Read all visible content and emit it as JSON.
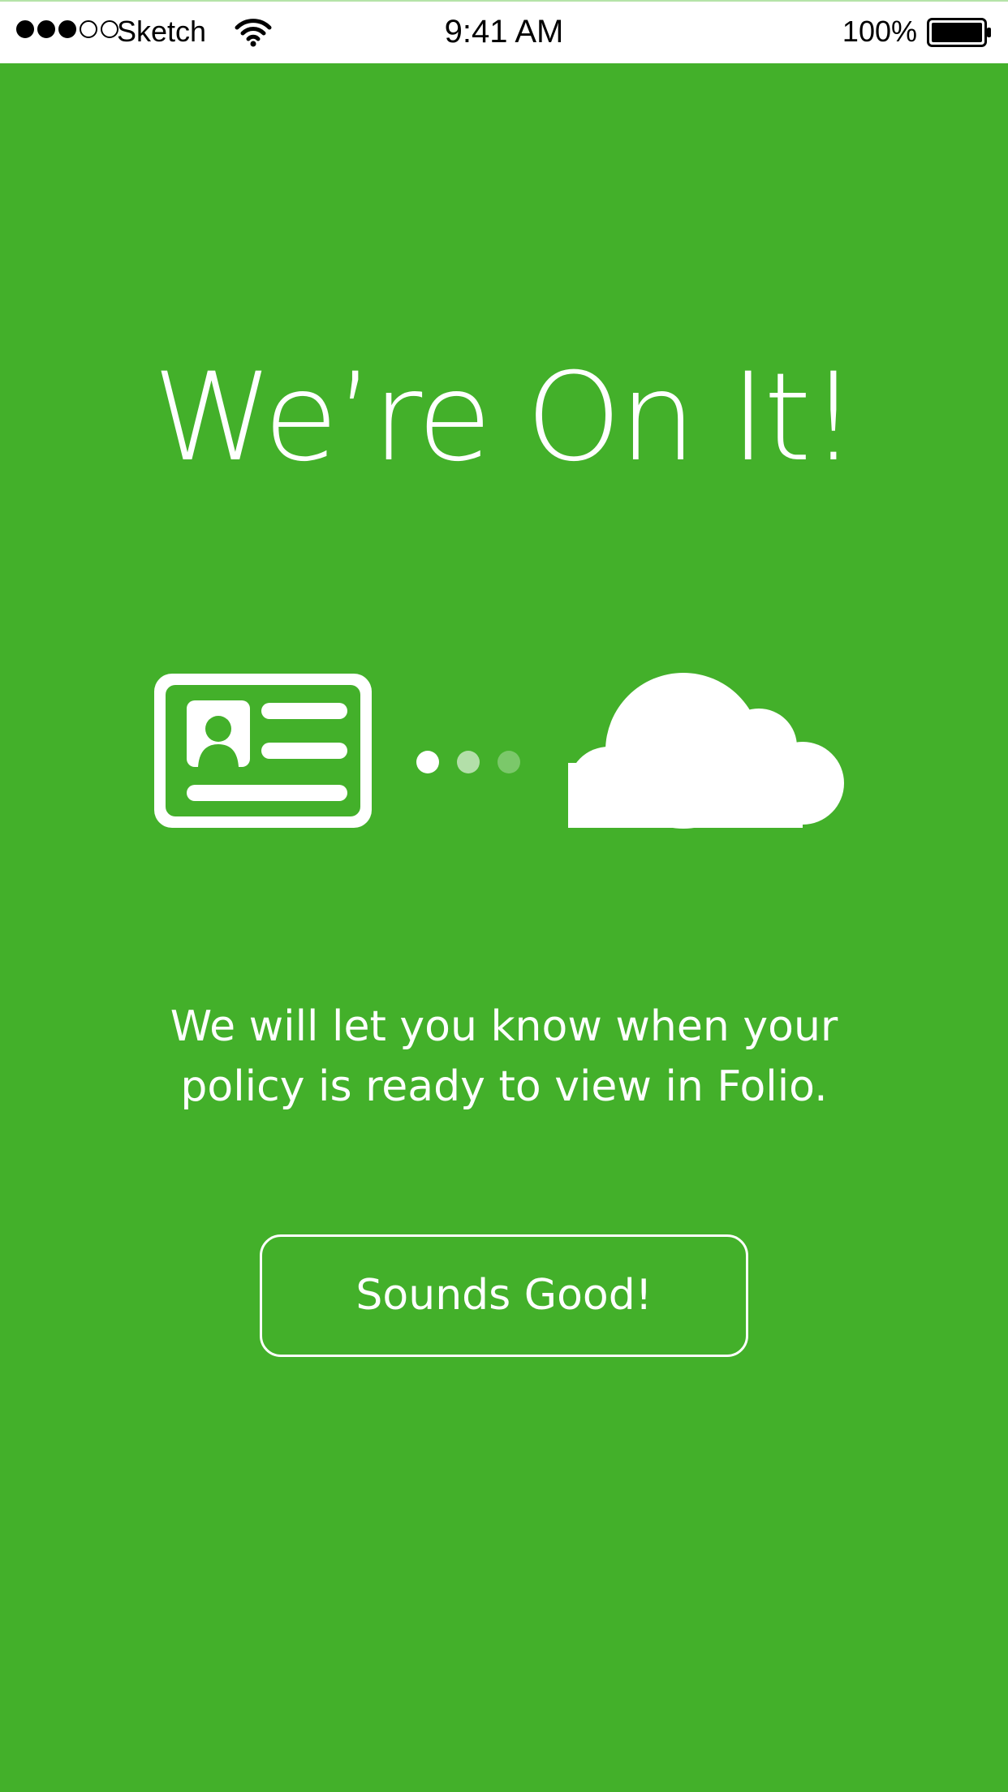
{
  "status_bar": {
    "carrier": "Sketch",
    "time": "9:41 AM",
    "battery_percent": "100%",
    "signal_bars_filled": 3,
    "signal_bars_total": 5
  },
  "main": {
    "title": "We’re On It!",
    "message": "We will let you know when your policy is ready to view in Folio.",
    "button_label": "Sounds Good!"
  },
  "illustration": {
    "left_icon": "id-card-icon",
    "progress_dots": 3,
    "right_icon": "cloud-icon"
  },
  "colors": {
    "background": "#43b02a",
    "foreground": "#ffffff",
    "status_bar_background": "#ffffff"
  }
}
